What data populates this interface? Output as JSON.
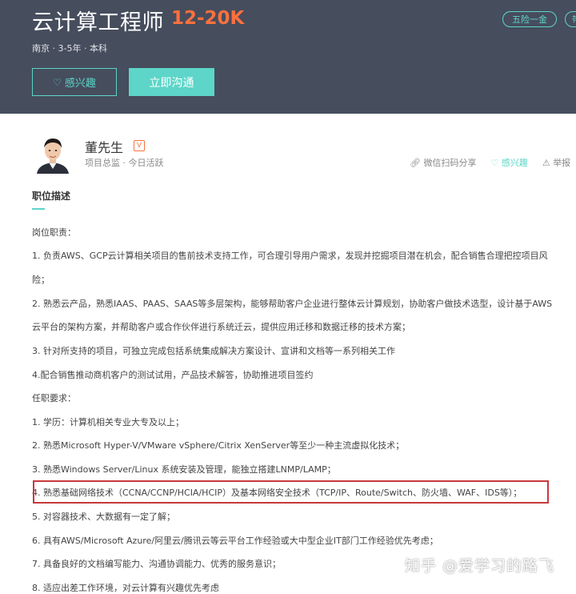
{
  "header": {
    "job_title": "云计算工程师",
    "salary": "12-20K",
    "meta": "南京 · 3-5年 · 本科",
    "interest_button": "感兴趣",
    "chat_button": "立即沟通",
    "tags": [
      "五险一金",
      "带"
    ]
  },
  "recruiter": {
    "name": "董先生",
    "badge": "V",
    "meta": "项目总监 · 今日活跃",
    "share": "微信扫码分享",
    "like": "感兴趣",
    "report": "举报"
  },
  "section": {
    "title": "职位描述"
  },
  "description": [
    "岗位职责：",
    "1. 负责AWS、GCP云计算相关项目的售前技术支持工作，可合理引导用户需求，发现并挖掘项目潜在机会，配合销售合理把控项目风",
    "险；",
    "2. 熟悉云产品，熟悉IAAS、PAAS、SAAS等多层架构，能够帮助客户企业进行整体云计算规划，协助客户做技术选型，设计基于AWS",
    "云平台的架构方案，并帮助客户或合作伙伴进行系统迁云，提供应用迁移和数据迁移的技术方案；",
    "3. 针对所支持的项目，可独立完成包括系统集成解决方案设计、宣讲和文档等一系列相关工作",
    "4.配合销售推动商机客户的测试试用，产品技术解答，协助推进项目签约",
    "任职要求：",
    "1. 学历：计算机相关专业大专及以上；",
    "2. 熟悉Microsoft Hyper-V/VMware vSphere/Citrix XenServer等至少一种主流虚拟化技术；",
    "3. 熟悉Windows Server/Linux 系统安装及管理，能独立搭建LNMP/LAMP；",
    "4. 熟悉基础网络技术（CCNA/CCNP/HCIA/HCIP）及基本网络安全技术（TCP/IP、Route/Switch、防火墙、WAF、IDS等）；",
    "5. 对容器技术、大数据有一定了解；",
    "6. 具有AWS/Microsoft Azure/阿里云/腾讯云等云平台工作经验或大中型企业IT部门工作经验优先考虑；",
    "7. 具备良好的文档编写能力、沟通协调能力、优秀的服务意识；",
    "8. 适应出差工作环境，对云计算有兴趣优先考虑"
  ],
  "watermark": "知乎 @爱学习的路飞",
  "colors": {
    "header_bg": "#464d5d",
    "accent": "#5dd5c8",
    "salary": "#fc703e",
    "highlight_border": "#c8393b"
  }
}
